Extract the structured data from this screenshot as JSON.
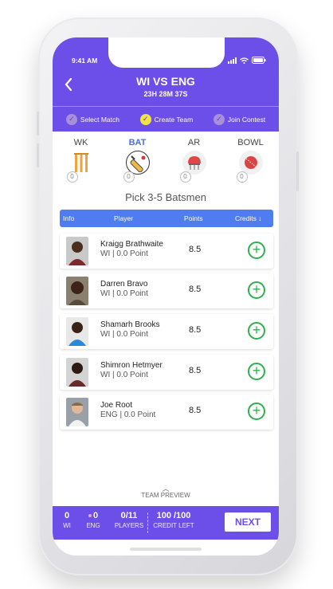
{
  "status": {
    "time": "9:41 AM"
  },
  "header": {
    "title": "WI VS ENG",
    "timer": "23H 28M 37S",
    "steps": [
      {
        "label": "Select Match",
        "active": false
      },
      {
        "label": "Create Team",
        "active": true
      },
      {
        "label": "Join Contest",
        "active": false
      }
    ]
  },
  "roles": [
    {
      "label": "WK",
      "count": "0",
      "icon": "wicket-icon",
      "active": false
    },
    {
      "label": "BAT",
      "count": "0",
      "icon": "bat-icon",
      "active": true
    },
    {
      "label": "AR",
      "count": "0",
      "icon": "helmet-icon",
      "active": false
    },
    {
      "label": "BOWL",
      "count": "0",
      "icon": "ball-icon",
      "active": false
    }
  ],
  "pick_text": "Pick 3-5 Batsmen",
  "table_head": {
    "info": "Info",
    "player": "Player",
    "points": "Points",
    "credits": "Credits ↓"
  },
  "players": [
    {
      "name": "Kraigg Brathwaite",
      "team": "WI | 0.0 Point",
      "points": "8.5"
    },
    {
      "name": "Darren Bravo",
      "team": "WI | 0.0 Point",
      "points": "8.5"
    },
    {
      "name": "Shamarh Brooks",
      "team": "WI | 0.0 Point",
      "points": "8.5"
    },
    {
      "name": "Shimron Hetmyer",
      "team": "WI | 0.0 Point",
      "points": "8.5"
    },
    {
      "name": "Joe Root",
      "team": "ENG | 0.0 Point",
      "points": "8.5"
    }
  ],
  "team_preview": "TEAM PREVIEW",
  "footer": {
    "wi_count": "0",
    "wi_label": "WI",
    "eng_count": "0",
    "eng_label": "ENG",
    "players_value": "0/11",
    "players_label": "PLAYERS",
    "credit_value": "100 /100",
    "credit_label": "CREDIT LEFT",
    "next_label": "NEXT"
  },
  "colors": {
    "primary": "#6c4ee8",
    "accent_blue": "#4f7cf0",
    "add_green": "#2db04d",
    "step_active": "#f2e441"
  }
}
